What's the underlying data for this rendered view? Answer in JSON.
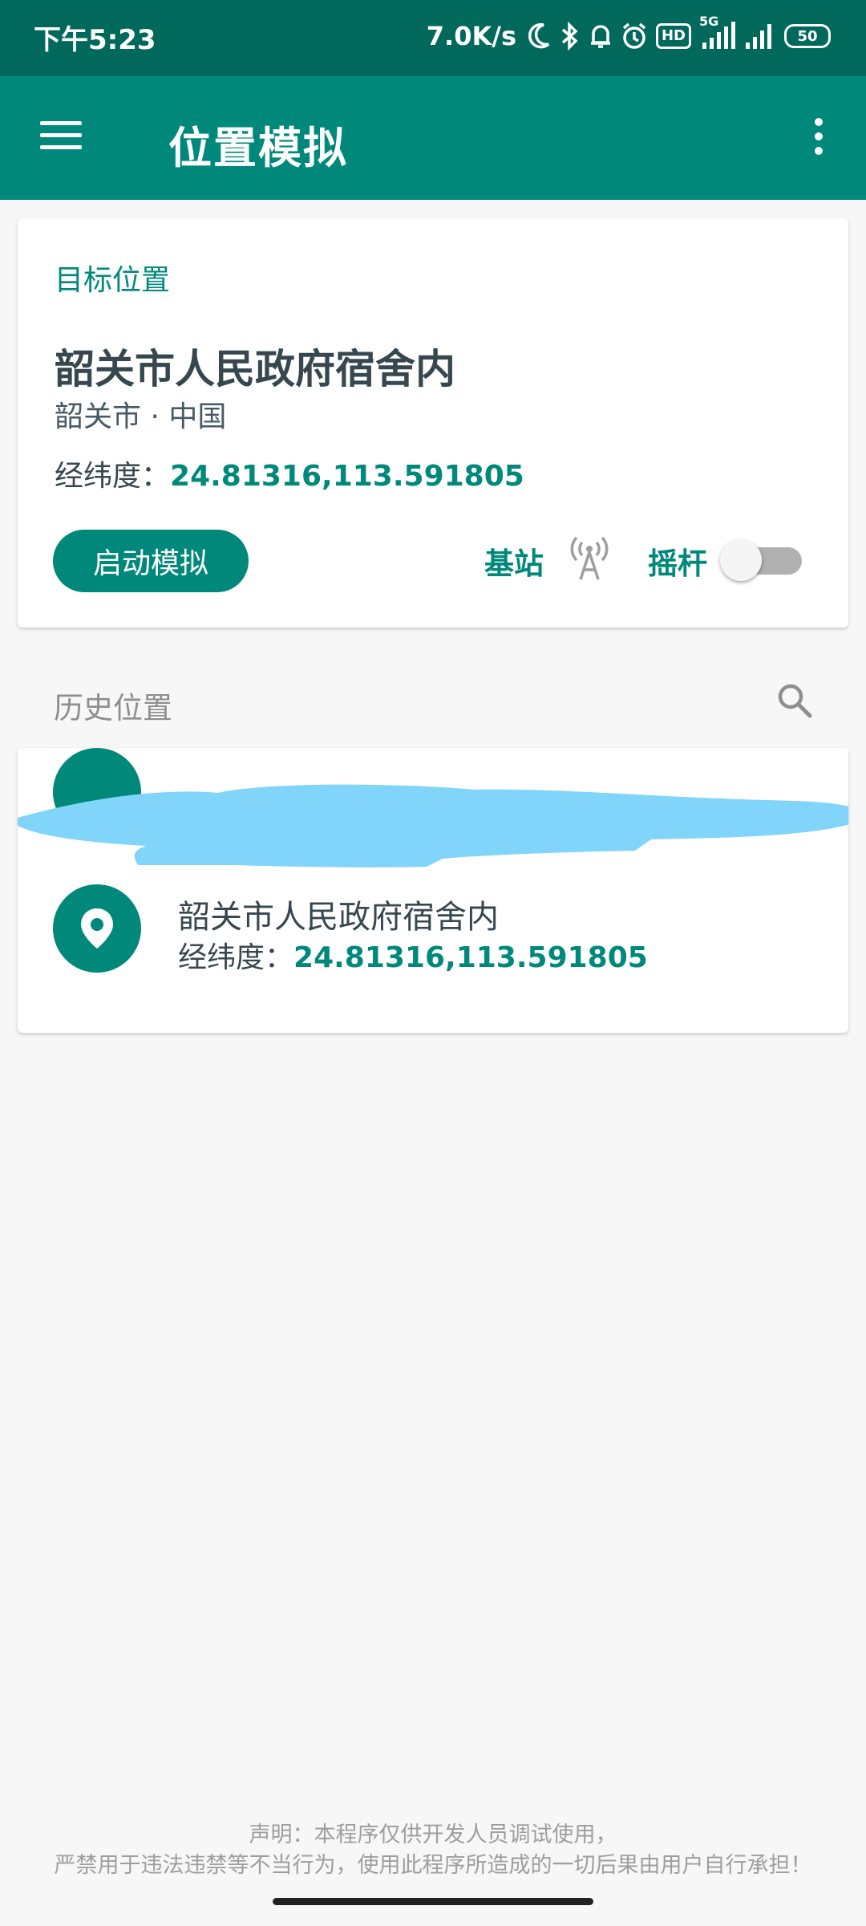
{
  "status_bar": {
    "time": "下午5:23",
    "speed": "7.0K/s",
    "hd": "HD",
    "network": "5G",
    "battery": "50",
    "icons": [
      "moon-icon",
      "bluetooth-icon",
      "bell-icon",
      "alarm-icon",
      "hd-icon",
      "signal-icon",
      "signal-icon",
      "battery-icon"
    ]
  },
  "app_bar": {
    "title": "位置模拟",
    "menu_icon": "menu-icon",
    "more_icon": "more-vert-icon"
  },
  "target": {
    "section_label": "目标位置",
    "place_name": "韶关市人民政府宿舍内",
    "city_country": "韶关市 · 中国",
    "coord_label": "经纬度：",
    "coord_value": "24.81316,113.591805",
    "start_button": "启动模拟",
    "base_station_label": "基站",
    "base_station_icon": "cell-tower-icon",
    "joystick_label": "摇杆",
    "joystick_enabled": false
  },
  "history": {
    "title": "历史位置",
    "search_icon": "search-icon",
    "items": [
      {
        "name": "韶关市人民政府宿舍内",
        "coord_label": "经纬度：",
        "coord_value": "24.81316,113.591805",
        "icon": "location-pin-icon"
      }
    ]
  },
  "footer": {
    "line1": "声明：本程序仅供开发人员调试使用，",
    "line2": "严禁用于违法违禁等不当行为，使用此程序所造成的一切后果由用户自行承担！"
  },
  "colors": {
    "status_bar": "#00695c",
    "app_bar": "#00897b",
    "accent": "#00897b",
    "redaction": "#81d4fa"
  }
}
